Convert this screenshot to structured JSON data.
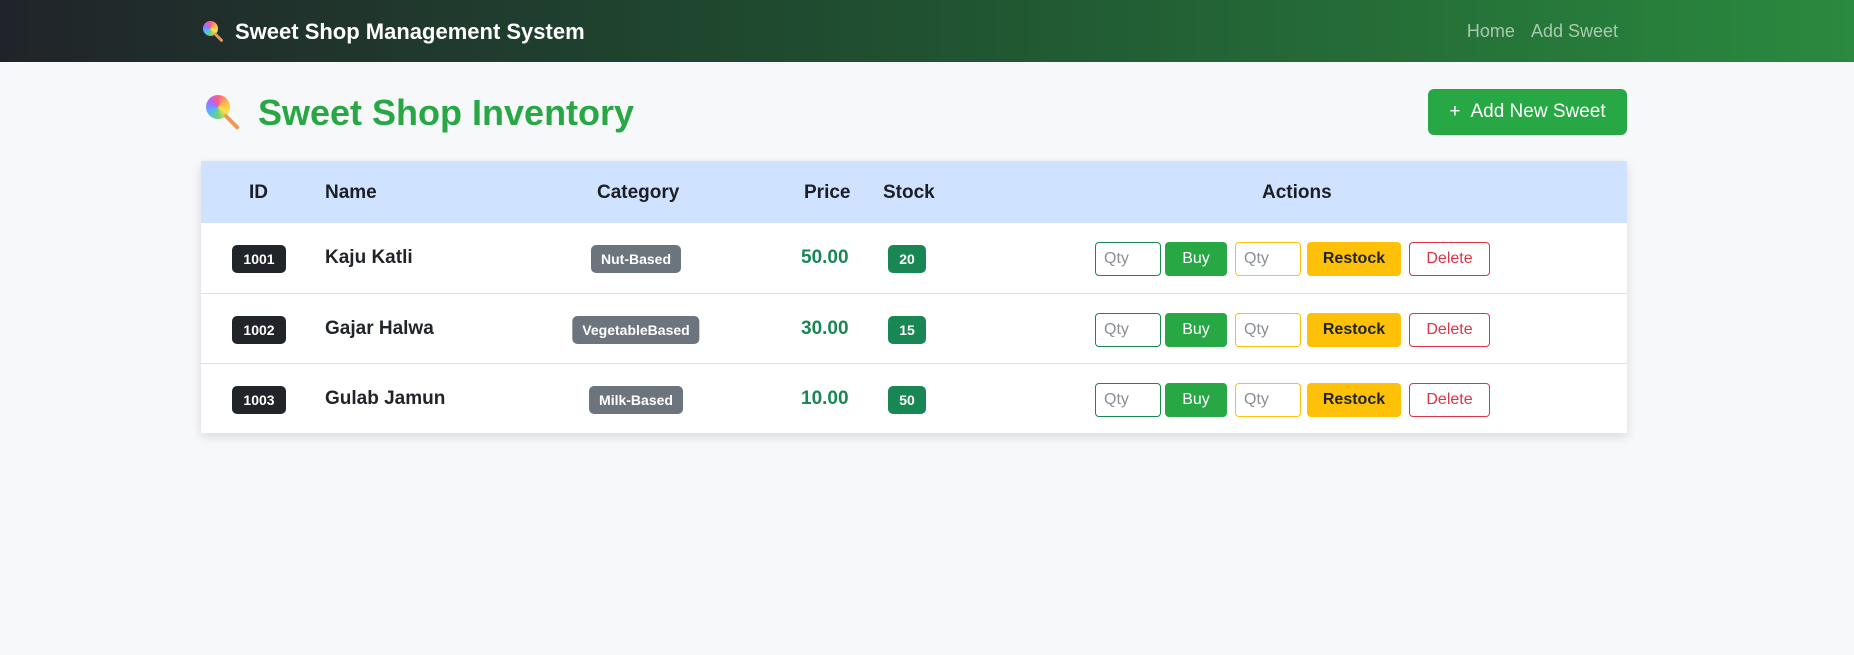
{
  "navbar": {
    "brand": "Sweet Shop Management System",
    "brand_icon": "lollipop-icon",
    "links": [
      "Home",
      "Add Sweet"
    ]
  },
  "page": {
    "title": "Sweet Shop Inventory",
    "title_icon": "lollipop-icon",
    "add_button_icon": "+",
    "add_button": "Add New Sweet"
  },
  "table": {
    "headers": [
      "ID",
      "Name",
      "Category",
      "Price",
      "Stock",
      "Actions"
    ],
    "rows": [
      {
        "id": "1001",
        "name": "Kaju Katli",
        "category": "Nut-Based",
        "price": "50.00",
        "stock": "20"
      },
      {
        "id": "1002",
        "name": "Gajar Halwa",
        "category": "VegetableBased",
        "price": "30.00",
        "stock": "15"
      },
      {
        "id": "1003",
        "name": "Gulab Jamun",
        "category": "Milk-Based",
        "price": "10.00",
        "stock": "50"
      }
    ],
    "actions": {
      "qty_placeholder": "Qty",
      "buy": "Buy",
      "restock": "Restock",
      "delete": "Delete"
    }
  },
  "colors": {
    "primary_green": "#28a745",
    "dark_green": "#198754",
    "warning": "#ffc107",
    "danger": "#dc3545",
    "header_bg": "#cfe2ff",
    "badge_dark": "#212529",
    "badge_gray": "#6c757d"
  }
}
